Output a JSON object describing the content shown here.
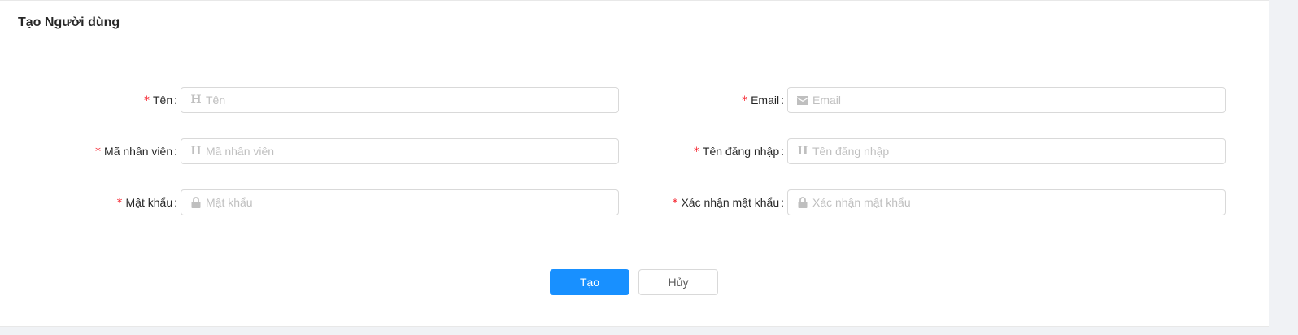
{
  "page": {
    "title": "Tạo Người dùng"
  },
  "form": {
    "name": {
      "label": "Tên",
      "placeholder": "Tên",
      "value": "",
      "icon": "h-icon"
    },
    "email": {
      "label": "Email",
      "placeholder": "Email",
      "value": "",
      "icon": "mail-icon"
    },
    "employee_code": {
      "label": "Mã nhân viên",
      "placeholder": "Mã nhân viên",
      "value": "",
      "icon": "h-icon"
    },
    "username": {
      "label": "Tên đăng nhập",
      "placeholder": "Tên đăng nhập",
      "value": "",
      "icon": "h-icon"
    },
    "password": {
      "label": "Mật khẩu",
      "placeholder": "Mật khẩu",
      "value": "",
      "icon": "lock-icon"
    },
    "confirm_password": {
      "label": "Xác nhận mật khẩu",
      "placeholder": "Xác nhận mật khẩu",
      "value": "",
      "icon": "lock-icon"
    },
    "required_mark": "*",
    "colon": ":"
  },
  "actions": {
    "create_label": "Tạo",
    "cancel_label": "Hủy"
  },
  "colors": {
    "primary": "#1890ff",
    "required": "#f5222d",
    "placeholder": "#bfbfbf",
    "border": "#d9d9d9"
  }
}
